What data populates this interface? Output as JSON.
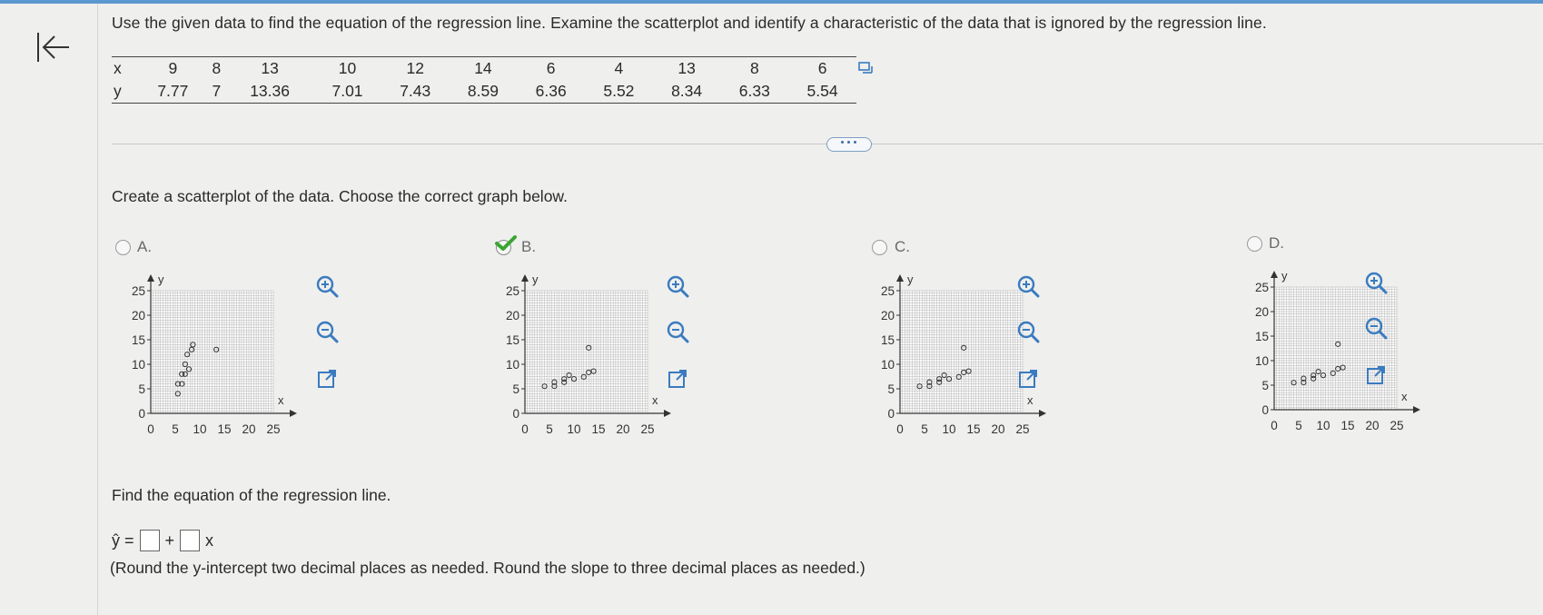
{
  "question": "Use the given data to find the equation of the regression line. Examine the scatterplot and identify a characteristic of the data that is ignored by the regression line.",
  "table": {
    "x_label": "x",
    "y_label": "y",
    "x": [
      "9",
      "8",
      "13",
      "10",
      "12",
      "14",
      "6",
      "4",
      "13",
      "8",
      "6"
    ],
    "y": [
      "7.77",
      "7",
      "13.36",
      "7.01",
      "7.43",
      "8.59",
      "6.36",
      "5.52",
      "8.34",
      "6.33",
      "5.54"
    ]
  },
  "prompt_scatter": "Create a scatterplot of the data. Choose the correct graph below.",
  "options": [
    {
      "label": "A.",
      "selected": false
    },
    {
      "label": "B.",
      "selected": true
    },
    {
      "label": "C.",
      "selected": false
    },
    {
      "label": "D.",
      "selected": false
    }
  ],
  "graph_axis": {
    "y_ticks": [
      "25",
      "20",
      "15",
      "10",
      "5",
      "0"
    ],
    "x_ticks": [
      "0",
      "5",
      "10",
      "15",
      "20",
      "25"
    ],
    "x_label": "x",
    "y_label": "y"
  },
  "prompt_regression": "Find the equation of the regression line.",
  "equation": {
    "lhs": "ŷ =",
    "plus": "+",
    "var": "x"
  },
  "note": "(Round the y-intercept two decimal places as needed. Round the slope to three decimal places as needed.)",
  "icons": {
    "back": "first-page-icon",
    "copy": "copy-icon",
    "more": "more-dots-icon",
    "zoom_in": "zoom-in-icon",
    "zoom_out": "zoom-out-icon",
    "open": "open-new-window-icon",
    "check": "check-icon"
  },
  "colors": {
    "accent": "#3a7bbf",
    "check": "#3aa531",
    "topbar": "#5a98cf"
  },
  "chart_data": [
    {
      "type": "scatter",
      "option": "A",
      "xlim": [
        0,
        25
      ],
      "ylim": [
        0,
        25
      ],
      "x": [
        7.77,
        7,
        13.36,
        7.01,
        7.43,
        8.59,
        6.36,
        5.52,
        8.34,
        6.33,
        5.54
      ],
      "y": [
        9,
        8,
        13,
        10,
        12,
        14,
        6,
        4,
        13,
        8,
        6
      ]
    },
    {
      "type": "scatter",
      "option": "B",
      "xlim": [
        0,
        25
      ],
      "ylim": [
        0,
        25
      ],
      "x": [
        9,
        8,
        13,
        10,
        12,
        14,
        6,
        4,
        13,
        8,
        6
      ],
      "y": [
        7.77,
        7,
        13.36,
        7.01,
        7.43,
        8.59,
        6.36,
        5.52,
        8.34,
        6.33,
        5.54
      ]
    },
    {
      "type": "scatter",
      "option": "C",
      "xlim": [
        0,
        25
      ],
      "ylim": [
        0,
        25
      ],
      "x": [
        9,
        8,
        13,
        10,
        12,
        14,
        6,
        4,
        13,
        8,
        6
      ],
      "y": [
        7.77,
        7,
        13.36,
        7.01,
        7.43,
        8.59,
        6.36,
        5.52,
        8.34,
        6.33,
        5.54
      ]
    },
    {
      "type": "scatter",
      "option": "D",
      "xlim": [
        0,
        25
      ],
      "ylim": [
        0,
        25
      ],
      "x": [
        9,
        8,
        13,
        10,
        12,
        14,
        6,
        4,
        13,
        8,
        6
      ],
      "y": [
        7.77,
        7,
        13.36,
        7.01,
        7.43,
        8.59,
        6.36,
        5.52,
        8.34,
        6.33,
        5.54
      ]
    }
  ]
}
